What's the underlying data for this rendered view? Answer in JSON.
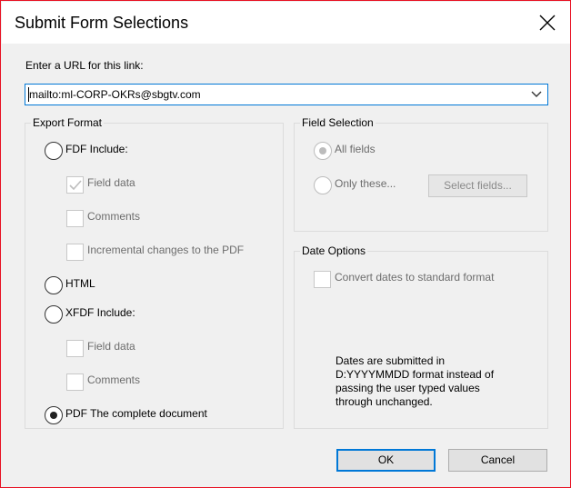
{
  "window": {
    "title": "Submit Form Selections"
  },
  "url": {
    "label": "Enter a URL for this link:",
    "value": "mailto:ml-CORP-OKRs@sbgtv.com"
  },
  "export_format": {
    "title": "Export Format",
    "fdf": {
      "label": "FDF  Include:",
      "selected": false
    },
    "fdf_field_data": {
      "label": "Field data",
      "checked": true
    },
    "fdf_comments": {
      "label": "Comments",
      "checked": false
    },
    "fdf_incremental": {
      "label": "Incremental changes to the PDF",
      "checked": false
    },
    "html": {
      "label": "HTML",
      "selected": false
    },
    "xfdf": {
      "label": "XFDF  Include:",
      "selected": false
    },
    "xfdf_field_data": {
      "label": "Field data",
      "checked": false
    },
    "xfdf_comments": {
      "label": "Comments",
      "checked": false
    },
    "pdf": {
      "label": "PDF  The complete document",
      "selected": true
    }
  },
  "field_selection": {
    "title": "Field Selection",
    "all_fields": {
      "label": "All fields",
      "selected": true
    },
    "only_these": {
      "label": "Only these...",
      "selected": false
    },
    "select_fields_button": "Select fields..."
  },
  "date_options": {
    "title": "Date Options",
    "convert": {
      "label": "Convert dates to standard format",
      "checked": false
    },
    "note_lines": [
      "Dates are submitted in",
      "D:YYYYMMDD format instead of",
      "passing the user typed values",
      "through unchanged."
    ]
  },
  "buttons": {
    "ok": "OK",
    "cancel": "Cancel"
  },
  "colors": {
    "accent": "#0078d7",
    "window_border": "#e81123"
  },
  "icons": {
    "close": "close-icon",
    "dropdown": "chevron-down-icon",
    "check": "checkmark-icon"
  }
}
